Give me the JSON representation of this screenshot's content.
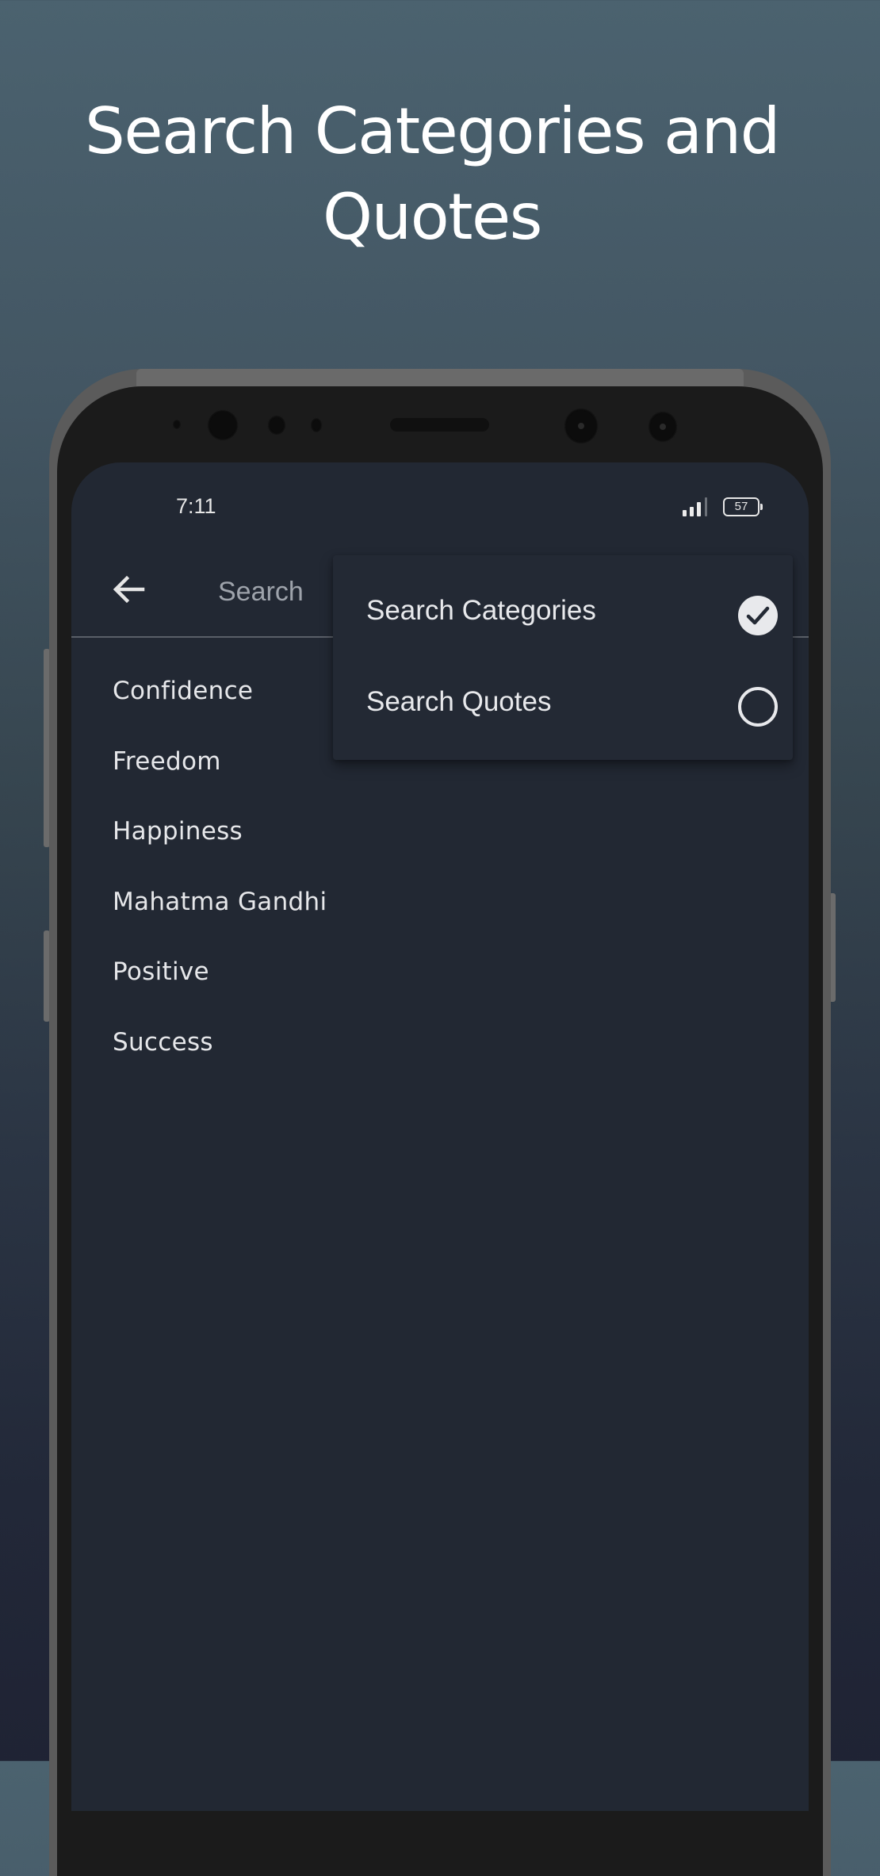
{
  "promo": {
    "title_line1": "Search Categories and",
    "title_line2": "Quotes"
  },
  "status_bar": {
    "time": "7:11",
    "signal_icon": "signal-bars-icon",
    "battery_level": "57",
    "battery_icon": "battery-icon"
  },
  "app_bar": {
    "back_icon": "arrow-left-icon",
    "search_placeholder": "Search",
    "search_value": ""
  },
  "categories": [
    "Confidence",
    "Freedom",
    "Happiness",
    "Mahatma Gandhi",
    "Positive",
    "Success"
  ],
  "search_mode_menu": {
    "items": [
      {
        "label": "Search Categories",
        "selected": true,
        "icon": "check-circle-icon"
      },
      {
        "label": "Search Quotes",
        "selected": false,
        "icon": "circle-outline-icon"
      }
    ]
  },
  "colors": {
    "screen_bg": "#222833",
    "popup_bg": "#232934",
    "text_primary": "#e6e7ea",
    "text_hint": "#9ea3ab",
    "divider": "#5a5f68"
  }
}
